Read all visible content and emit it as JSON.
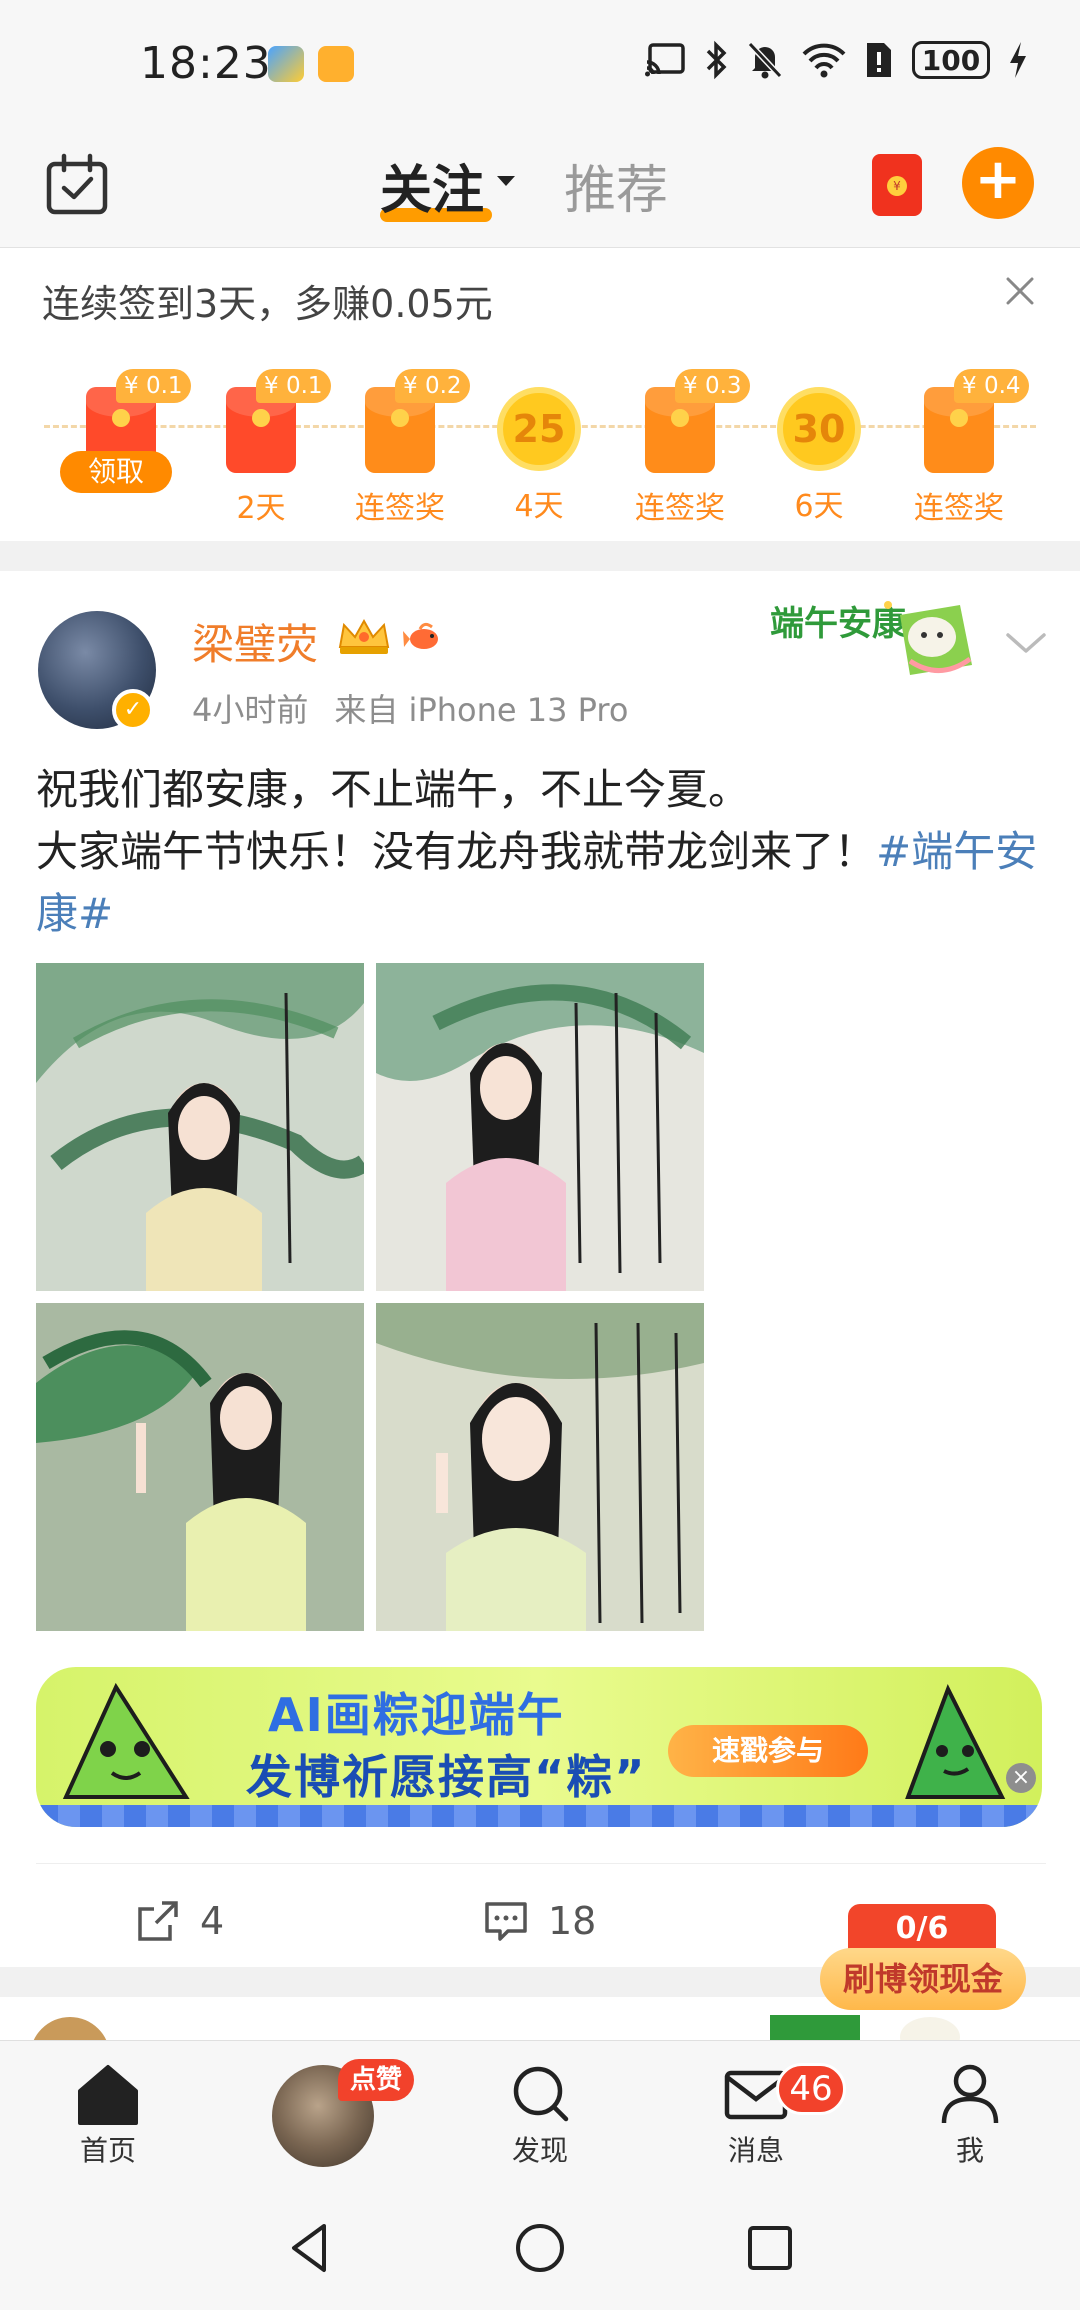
{
  "status_bar": {
    "time": "18:23",
    "battery": "100"
  },
  "top_nav": {
    "tab_follow": "关注",
    "tab_recommend": "推荐"
  },
  "checkin": {
    "title": "连续签到3天，多赚0.05元",
    "claim_label": "领取",
    "days": [
      {
        "label": "",
        "amount": "¥ 0.1",
        "kind": "packet"
      },
      {
        "label": "2天",
        "amount": "¥ 0.1",
        "kind": "packet"
      },
      {
        "label": "连签奖",
        "amount": "¥ 0.2",
        "kind": "packet-orange"
      },
      {
        "label": "4天",
        "amount": "",
        "coin": "25",
        "kind": "coin"
      },
      {
        "label": "连签奖",
        "amount": "¥ 0.3",
        "kind": "packet-orange"
      },
      {
        "label": "6天",
        "amount": "",
        "coin": "30",
        "kind": "coin"
      },
      {
        "label": "连签奖",
        "amount": "¥ 0.4",
        "kind": "packet-orange"
      }
    ]
  },
  "post": {
    "username": "梁璧荧",
    "time": "4小时前",
    "source": "来自 iPhone 13 Pro",
    "festival_badge": "端午安康",
    "text_line1": "祝我们都安康，不止端午，不止今夏。",
    "text_line2": "大家端午节快乐！没有龙舟我就带龙剑来了！",
    "hashtag": "#端午安康#",
    "ad": {
      "title": "AI画粽迎端午",
      "subtitle": "发博祈愿接高“粽”",
      "cta": "速戳参与"
    },
    "actions": {
      "repost_count": "4",
      "comment_count": "18"
    }
  },
  "reward_float": {
    "progress": "0/6",
    "label": "刷博领现金"
  },
  "tab_bar": {
    "home": "首页",
    "discover": "发现",
    "messages": "消息",
    "me": "我",
    "like_bubble": "点赞",
    "message_badge": "46"
  },
  "colors": {
    "accent_orange": "#ff8a00",
    "username_orange": "#f07d2a",
    "hashtag_blue": "#4b7fb9",
    "badge_red": "#f2422b"
  }
}
